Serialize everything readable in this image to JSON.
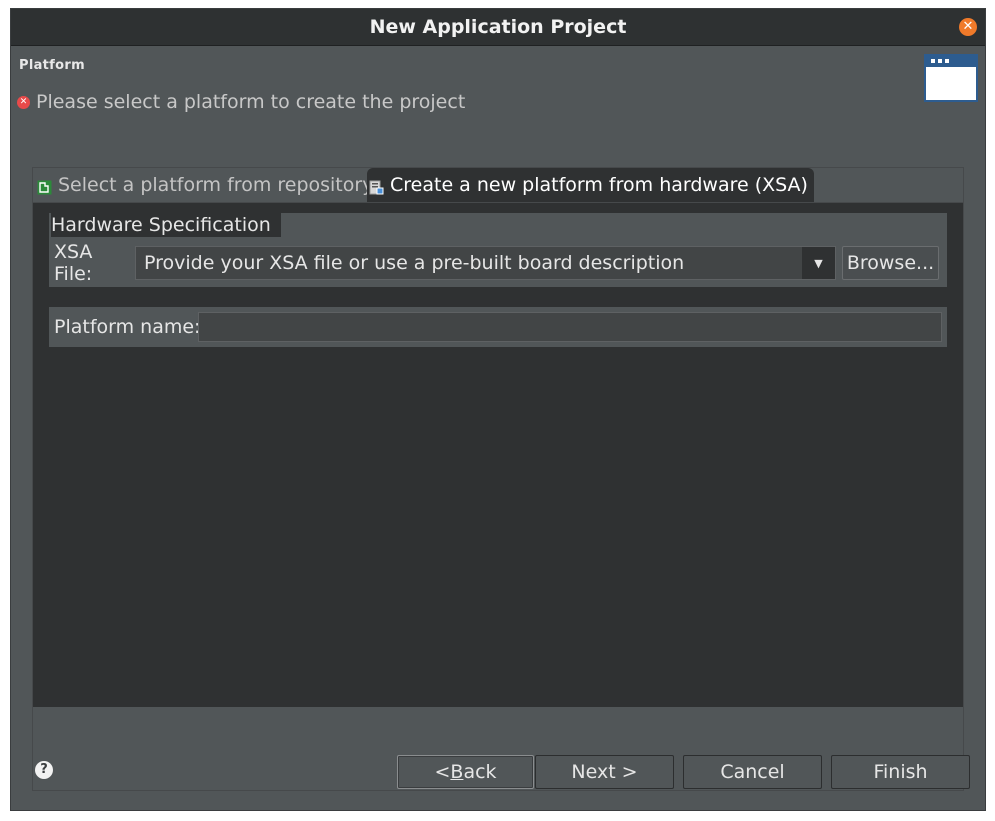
{
  "window": {
    "title": "New Application Project"
  },
  "header": {
    "section_title": "Platform",
    "error_message": "Please select a platform to create the project"
  },
  "tabs": [
    {
      "label": "Select a platform from repository",
      "active": false
    },
    {
      "label": "Create a new platform from hardware (XSA)",
      "active": true
    }
  ],
  "hardware_spec": {
    "group_label": "Hardware Specification",
    "xsa_label": "XSA File:",
    "xsa_value": "Provide your XSA file or use a pre-built board description",
    "browse_label": "Browse..."
  },
  "platform_name": {
    "label": "Platform name:",
    "value": ""
  },
  "buttons": {
    "back_prefix": "< ",
    "back_mnemonic": "B",
    "back_rest": "ack",
    "next": "Next >",
    "cancel": "Cancel",
    "finish": "Finish"
  },
  "colors": {
    "dialog_bg": "#515658",
    "panel_bg": "#2f3132",
    "title_bar": "#2e3132",
    "close_button": "#f07a2a",
    "error_icon": "#e84a4a",
    "wizard_icon": "#2d5c8f"
  },
  "icons": {
    "close": "close-icon",
    "error": "error-icon",
    "wizard": "wizard-banner-icon",
    "repo_tab": "platform-repo-icon",
    "hw_tab": "hardware-platform-icon",
    "dropdown": "chevron-down-icon",
    "help": "help-icon"
  }
}
